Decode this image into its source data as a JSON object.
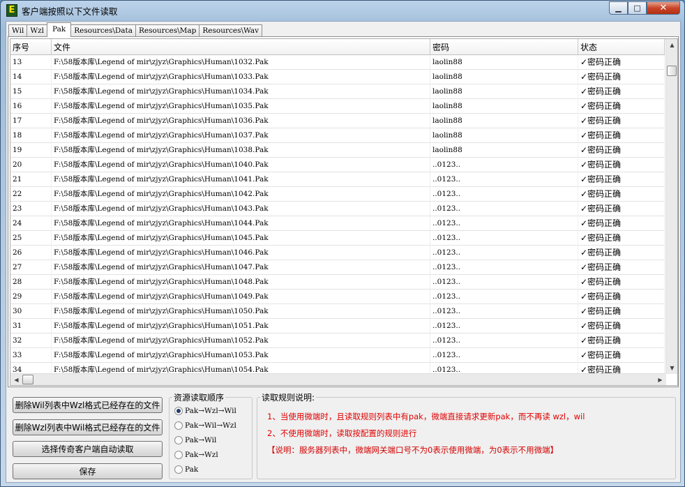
{
  "window": {
    "title": "客户端按照以下文件读取",
    "app_icon": "E",
    "min": "▁",
    "max": "□",
    "close": "✕"
  },
  "tabs": [
    "Wil",
    "Wzl",
    "Pak",
    "Resources\\Data",
    "Resources\\Map",
    "Resources\\Wav"
  ],
  "active_tab": 2,
  "table": {
    "columns": [
      "序号",
      "文件",
      "密码",
      "状态"
    ],
    "rows": [
      [
        "13",
        "F:\\58版本库\\Legend of mir\\zjyz\\Graphics\\Human\\1032.Pak",
        "laolin88",
        "✓密码正确"
      ],
      [
        "14",
        "F:\\58版本库\\Legend of mir\\zjyz\\Graphics\\Human\\1033.Pak",
        "laolin88",
        "✓密码正确"
      ],
      [
        "15",
        "F:\\58版本库\\Legend of mir\\zjyz\\Graphics\\Human\\1034.Pak",
        "laolin88",
        "✓密码正确"
      ],
      [
        "16",
        "F:\\58版本库\\Legend of mir\\zjyz\\Graphics\\Human\\1035.Pak",
        "laolin88",
        "✓密码正确"
      ],
      [
        "17",
        "F:\\58版本库\\Legend of mir\\zjyz\\Graphics\\Human\\1036.Pak",
        "laolin88",
        "✓密码正确"
      ],
      [
        "18",
        "F:\\58版本库\\Legend of mir\\zjyz\\Graphics\\Human\\1037.Pak",
        "laolin88",
        "✓密码正确"
      ],
      [
        "19",
        "F:\\58版本库\\Legend of mir\\zjyz\\Graphics\\Human\\1038.Pak",
        "laolin88",
        "✓密码正确"
      ],
      [
        "20",
        "F:\\58版本库\\Legend of mir\\zjyz\\Graphics\\Human\\1040.Pak",
        "..0123..",
        "✓密码正确"
      ],
      [
        "21",
        "F:\\58版本库\\Legend of mir\\zjyz\\Graphics\\Human\\1041.Pak",
        "..0123..",
        "✓密码正确"
      ],
      [
        "22",
        "F:\\58版本库\\Legend of mir\\zjyz\\Graphics\\Human\\1042.Pak",
        "..0123..",
        "✓密码正确"
      ],
      [
        "23",
        "F:\\58版本库\\Legend of mir\\zjyz\\Graphics\\Human\\1043.Pak",
        "..0123..",
        "✓密码正确"
      ],
      [
        "24",
        "F:\\58版本库\\Legend of mir\\zjyz\\Graphics\\Human\\1044.Pak",
        "..0123..",
        "✓密码正确"
      ],
      [
        "25",
        "F:\\58版本库\\Legend of mir\\zjyz\\Graphics\\Human\\1045.Pak",
        "..0123..",
        "✓密码正确"
      ],
      [
        "26",
        "F:\\58版本库\\Legend of mir\\zjyz\\Graphics\\Human\\1046.Pak",
        "..0123..",
        "✓密码正确"
      ],
      [
        "27",
        "F:\\58版本库\\Legend of mir\\zjyz\\Graphics\\Human\\1047.Pak",
        "..0123..",
        "✓密码正确"
      ],
      [
        "28",
        "F:\\58版本库\\Legend of mir\\zjyz\\Graphics\\Human\\1048.Pak",
        "..0123..",
        "✓密码正确"
      ],
      [
        "29",
        "F:\\58版本库\\Legend of mir\\zjyz\\Graphics\\Human\\1049.Pak",
        "..0123..",
        "✓密码正确"
      ],
      [
        "30",
        "F:\\58版本库\\Legend of mir\\zjyz\\Graphics\\Human\\1050.Pak",
        "..0123..",
        "✓密码正确"
      ],
      [
        "31",
        "F:\\58版本库\\Legend of mir\\zjyz\\Graphics\\Human\\1051.Pak",
        "..0123..",
        "✓密码正确"
      ],
      [
        "32",
        "F:\\58版本库\\Legend of mir\\zjyz\\Graphics\\Human\\1052.Pak",
        "..0123..",
        "✓密码正确"
      ],
      [
        "33",
        "F:\\58版本库\\Legend of mir\\zjyz\\Graphics\\Human\\1053.Pak",
        "..0123..",
        "✓密码正确"
      ],
      [
        "34",
        "F:\\58版本库\\Legend of mir\\zjyz\\Graphics\\Human\\1054.Pak",
        "..0123..",
        "✓密码正确"
      ]
    ]
  },
  "buttons": {
    "del_wil": "删除Wil列表中Wzl格式已经存在的文件",
    "del_wzl": "删除Wzl列表中Wil格式已经存在的文件",
    "auto_read": "选择传奇客户端自动读取",
    "save": "保存"
  },
  "order_group": {
    "label": "资源读取顺序",
    "options": [
      "Pak→Wzl→Wil",
      "Pak→Wil→Wzl",
      "Pak→Wil",
      "Pak→Wzl",
      "Pak"
    ],
    "selected": 0
  },
  "rules_group": {
    "label": "读取规则说明:",
    "line1": "1、当使用微端时，且读取规则列表中有pak，微端直接请求更新pak，而不再读 wzl，wil",
    "line2": "2、不使用微端时，读取按配置的规则进行",
    "line3": "【说明：服务器列表中，微端网关端口号不为0表示使用微端，为0表示不用微端】"
  },
  "icons": {
    "scroll_up": "up-arrow-icon",
    "scroll_down": "down-arrow-icon",
    "scroll_left": "left-arrow-icon",
    "scroll_right": "right-arrow-icon"
  }
}
